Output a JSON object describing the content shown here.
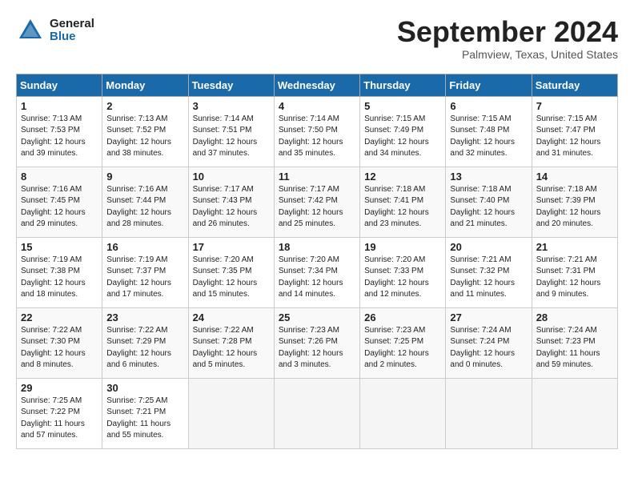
{
  "header": {
    "logo_general": "General",
    "logo_blue": "Blue",
    "title": "September 2024",
    "location": "Palmview, Texas, United States"
  },
  "weekdays": [
    "Sunday",
    "Monday",
    "Tuesday",
    "Wednesday",
    "Thursday",
    "Friday",
    "Saturday"
  ],
  "weeks": [
    [
      {
        "day": "1",
        "sunrise": "7:13 AM",
        "sunset": "7:53 PM",
        "daylight": "12 hours and 39 minutes."
      },
      {
        "day": "2",
        "sunrise": "7:13 AM",
        "sunset": "7:52 PM",
        "daylight": "12 hours and 38 minutes."
      },
      {
        "day": "3",
        "sunrise": "7:14 AM",
        "sunset": "7:51 PM",
        "daylight": "12 hours and 37 minutes."
      },
      {
        "day": "4",
        "sunrise": "7:14 AM",
        "sunset": "7:50 PM",
        "daylight": "12 hours and 35 minutes."
      },
      {
        "day": "5",
        "sunrise": "7:15 AM",
        "sunset": "7:49 PM",
        "daylight": "12 hours and 34 minutes."
      },
      {
        "day": "6",
        "sunrise": "7:15 AM",
        "sunset": "7:48 PM",
        "daylight": "12 hours and 32 minutes."
      },
      {
        "day": "7",
        "sunrise": "7:15 AM",
        "sunset": "7:47 PM",
        "daylight": "12 hours and 31 minutes."
      }
    ],
    [
      {
        "day": "8",
        "sunrise": "7:16 AM",
        "sunset": "7:45 PM",
        "daylight": "12 hours and 29 minutes."
      },
      {
        "day": "9",
        "sunrise": "7:16 AM",
        "sunset": "7:44 PM",
        "daylight": "12 hours and 28 minutes."
      },
      {
        "day": "10",
        "sunrise": "7:17 AM",
        "sunset": "7:43 PM",
        "daylight": "12 hours and 26 minutes."
      },
      {
        "day": "11",
        "sunrise": "7:17 AM",
        "sunset": "7:42 PM",
        "daylight": "12 hours and 25 minutes."
      },
      {
        "day": "12",
        "sunrise": "7:18 AM",
        "sunset": "7:41 PM",
        "daylight": "12 hours and 23 minutes."
      },
      {
        "day": "13",
        "sunrise": "7:18 AM",
        "sunset": "7:40 PM",
        "daylight": "12 hours and 21 minutes."
      },
      {
        "day": "14",
        "sunrise": "7:18 AM",
        "sunset": "7:39 PM",
        "daylight": "12 hours and 20 minutes."
      }
    ],
    [
      {
        "day": "15",
        "sunrise": "7:19 AM",
        "sunset": "7:38 PM",
        "daylight": "12 hours and 18 minutes."
      },
      {
        "day": "16",
        "sunrise": "7:19 AM",
        "sunset": "7:37 PM",
        "daylight": "12 hours and 17 minutes."
      },
      {
        "day": "17",
        "sunrise": "7:20 AM",
        "sunset": "7:35 PM",
        "daylight": "12 hours and 15 minutes."
      },
      {
        "day": "18",
        "sunrise": "7:20 AM",
        "sunset": "7:34 PM",
        "daylight": "12 hours and 14 minutes."
      },
      {
        "day": "19",
        "sunrise": "7:20 AM",
        "sunset": "7:33 PM",
        "daylight": "12 hours and 12 minutes."
      },
      {
        "day": "20",
        "sunrise": "7:21 AM",
        "sunset": "7:32 PM",
        "daylight": "12 hours and 11 minutes."
      },
      {
        "day": "21",
        "sunrise": "7:21 AM",
        "sunset": "7:31 PM",
        "daylight": "12 hours and 9 minutes."
      }
    ],
    [
      {
        "day": "22",
        "sunrise": "7:22 AM",
        "sunset": "7:30 PM",
        "daylight": "12 hours and 8 minutes."
      },
      {
        "day": "23",
        "sunrise": "7:22 AM",
        "sunset": "7:29 PM",
        "daylight": "12 hours and 6 minutes."
      },
      {
        "day": "24",
        "sunrise": "7:22 AM",
        "sunset": "7:28 PM",
        "daylight": "12 hours and 5 minutes."
      },
      {
        "day": "25",
        "sunrise": "7:23 AM",
        "sunset": "7:26 PM",
        "daylight": "12 hours and 3 minutes."
      },
      {
        "day": "26",
        "sunrise": "7:23 AM",
        "sunset": "7:25 PM",
        "daylight": "12 hours and 2 minutes."
      },
      {
        "day": "27",
        "sunrise": "7:24 AM",
        "sunset": "7:24 PM",
        "daylight": "12 hours and 0 minutes."
      },
      {
        "day": "28",
        "sunrise": "7:24 AM",
        "sunset": "7:23 PM",
        "daylight": "11 hours and 59 minutes."
      }
    ],
    [
      {
        "day": "29",
        "sunrise": "7:25 AM",
        "sunset": "7:22 PM",
        "daylight": "11 hours and 57 minutes."
      },
      {
        "day": "30",
        "sunrise": "7:25 AM",
        "sunset": "7:21 PM",
        "daylight": "11 hours and 55 minutes."
      },
      null,
      null,
      null,
      null,
      null
    ]
  ]
}
